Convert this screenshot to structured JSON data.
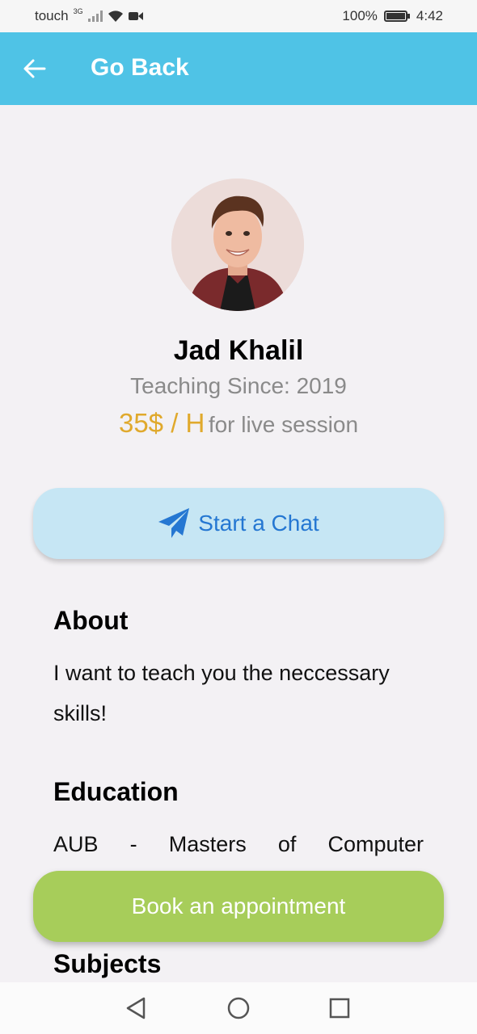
{
  "status_bar": {
    "carrier": "touch",
    "network": "3G",
    "battery": "100%",
    "time": "4:42"
  },
  "appbar": {
    "title": "Go Back"
  },
  "profile": {
    "name": "Jad Khalil",
    "teaching_since": "Teaching Since: 2019",
    "price": "35$ / H",
    "price_suffix": "for live session"
  },
  "actions": {
    "chat_label": "Start a Chat",
    "book_label": "Book an appointment"
  },
  "sections": {
    "about_title": "About",
    "about_text": "I want to teach you the neccessary skills!",
    "education_title": "Education",
    "education_text": "AUB - Masters of Computer",
    "subjects_title": "Subjects"
  },
  "colors": {
    "appbar": "#4fc3e6",
    "price": "#e0a92c",
    "chat_button": "#c6e6f4",
    "chat_text": "#2577d2",
    "book_button": "#a7cd5a"
  },
  "icons": {
    "back": "arrow-left-icon",
    "chat": "paper-plane-icon",
    "nav_back": "triangle-back-icon",
    "nav_home": "circle-home-icon",
    "nav_recents": "square-recents-icon"
  }
}
